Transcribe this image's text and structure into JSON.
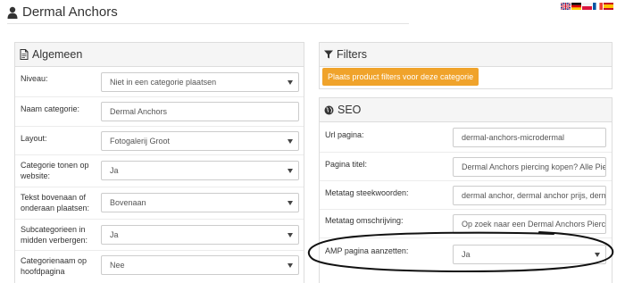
{
  "page": {
    "title": "Dermal Anchors",
    "languages": [
      "English",
      "German",
      "Polish",
      "French",
      "Spanish"
    ]
  },
  "algemeen": {
    "heading": "Algemeen",
    "rows": [
      {
        "label": "Niveau:",
        "value": "Niet in een categorie plaatsen",
        "type": "select"
      },
      {
        "label": "Naam categorie:",
        "value": "Dermal Anchors",
        "type": "input"
      },
      {
        "label": "Layout:",
        "value": "Fotogalerij Groot",
        "type": "select"
      },
      {
        "label": "Categorie tonen op website:",
        "value": "Ja",
        "type": "select"
      },
      {
        "label": "Tekst bovenaan of onderaan plaatsen:",
        "value": "Bovenaan",
        "type": "select"
      },
      {
        "label": "Subcategorieen in midden verbergen:",
        "value": "Ja",
        "type": "select"
      },
      {
        "label": "Categorienaam op hoofdpagina",
        "value": "Nee",
        "type": "select"
      }
    ]
  },
  "filters": {
    "heading": "Filters",
    "button_label": "Plaats product filters voor deze categorie"
  },
  "seo": {
    "heading": "SEO",
    "rows": [
      {
        "label": "Url pagina:",
        "value": "dermal-anchors-microdermal",
        "type": "input"
      },
      {
        "label": "Pagina titel:",
        "value": "Dermal Anchors piercing kopen? Alle Piercings",
        "type": "input"
      },
      {
        "label": "Metatag steekwoorden:",
        "value": "dermal anchor, dermal anchor prijs, dermal anchor",
        "type": "input"
      },
      {
        "label": "Metatag omschrijving:",
        "value": "Op zoek naar een Dermal Anchors Piercing?",
        "type": "input"
      },
      {
        "label": "AMP pagina aanzetten:",
        "value": "Ja",
        "type": "select"
      }
    ]
  },
  "colors": {
    "accent_orange": "#f0a32b",
    "annotation_stroke": "#111111"
  }
}
